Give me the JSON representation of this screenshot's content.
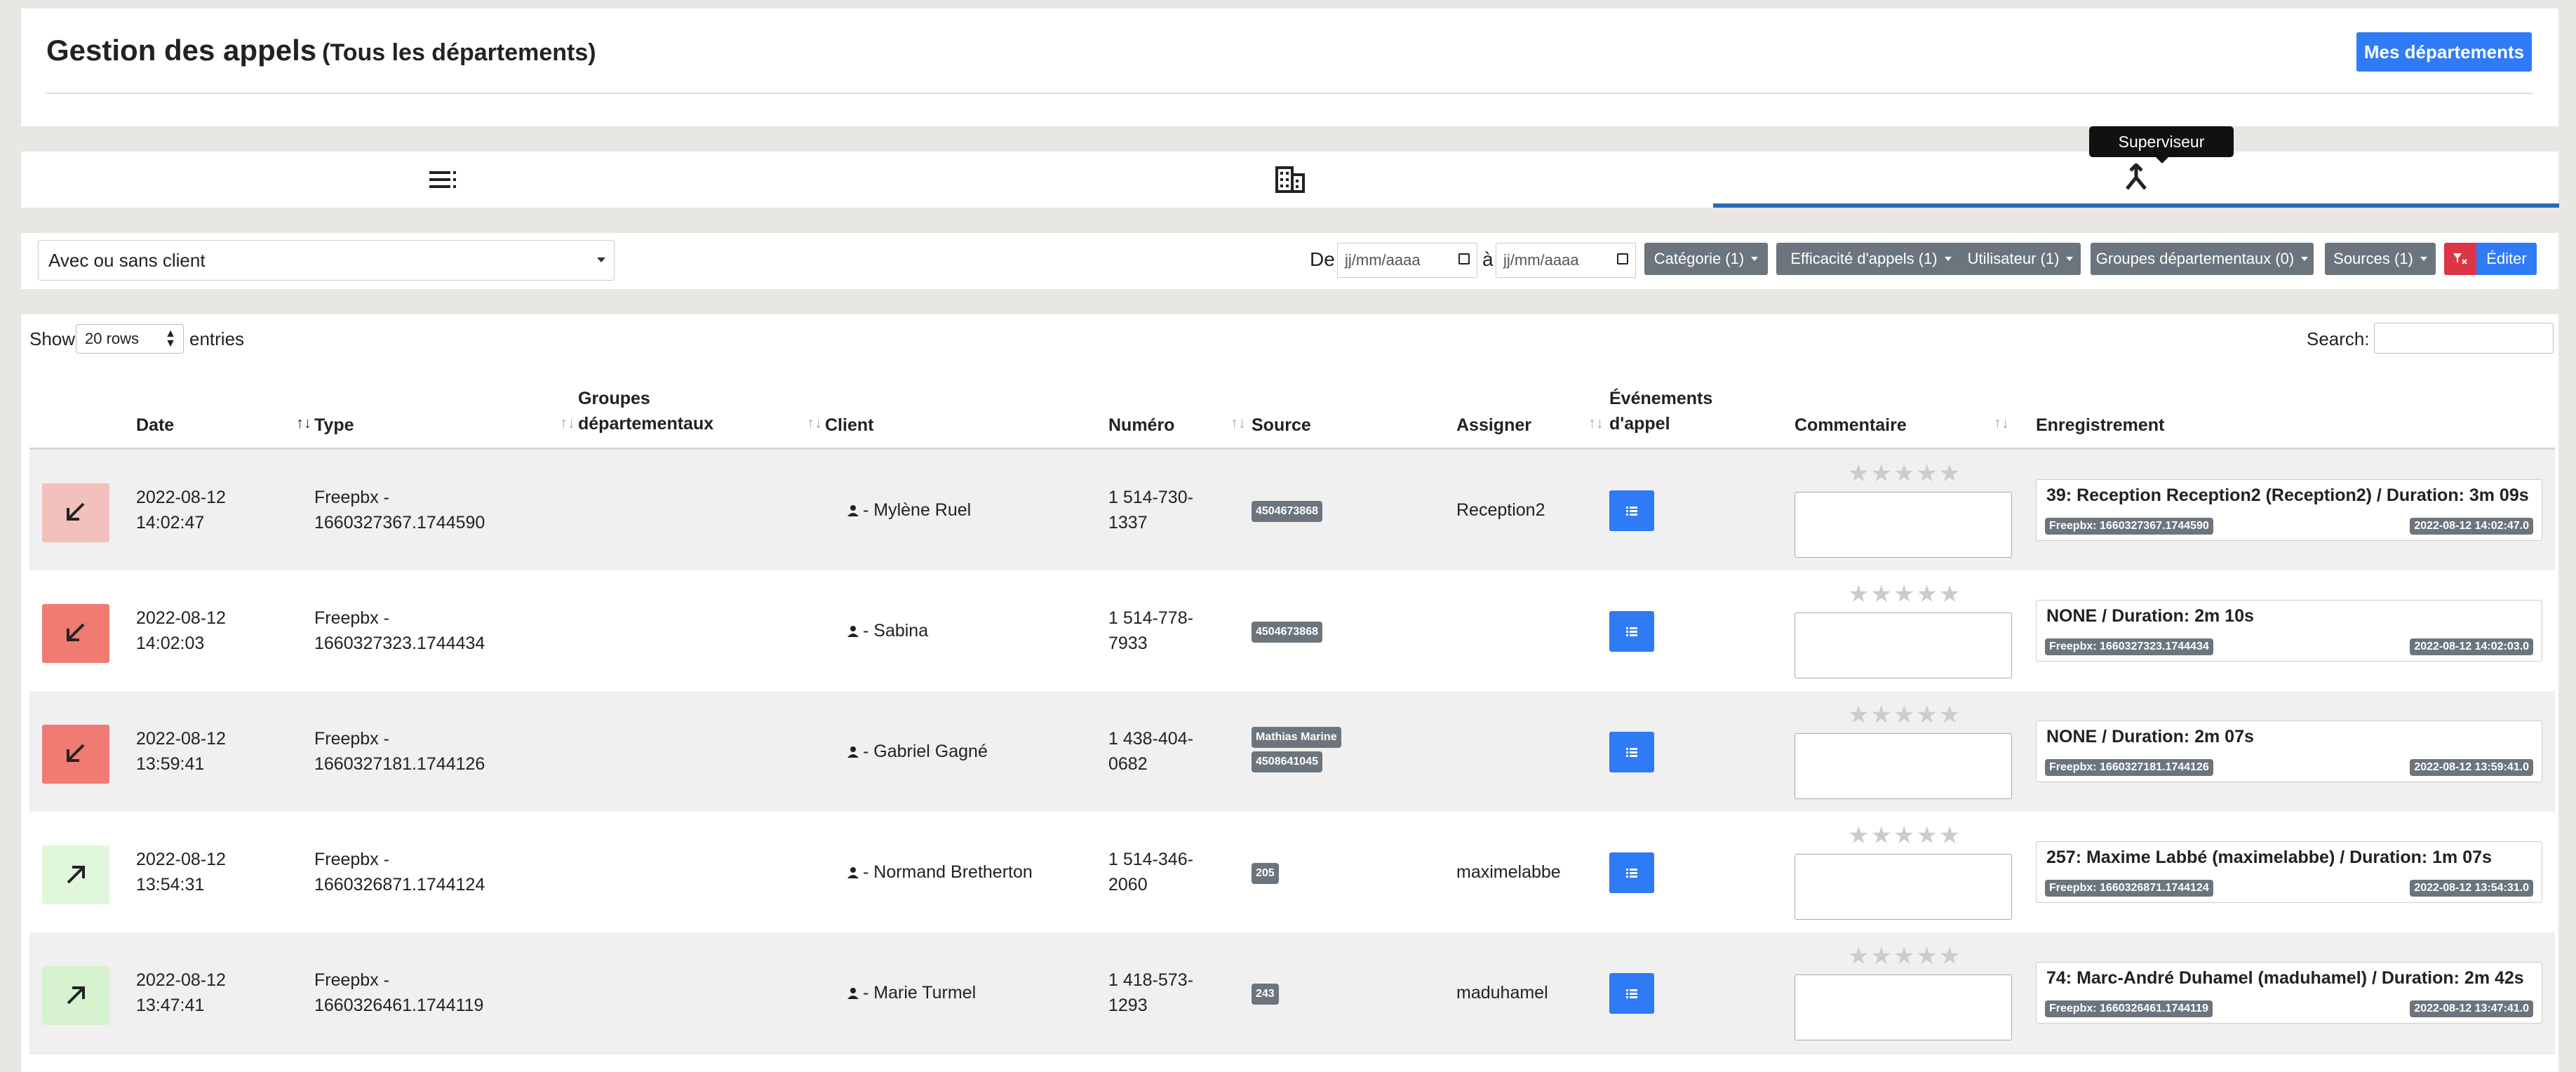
{
  "header": {
    "title": "Gestion des appels",
    "subtitle": "(Tous les départements)",
    "mes_departements": "Mes départements"
  },
  "tabs": {
    "tooltip": "Superviseur",
    "icons": [
      "list-icon",
      "building-icon",
      "merge-icon"
    ],
    "active": 2
  },
  "filters": {
    "client_select": "Avec ou sans client",
    "de_label": "De",
    "a_label": "à",
    "date_placeholder": "jj/mm/aaaa",
    "categorie": "Catégorie (1)",
    "efficacite": "Efficacité d'appels (1)",
    "utilisateur": "Utilisateur (1)",
    "groupes": "Groupes départementaux (0)",
    "sources": "Sources (1)",
    "editer": "Éditer"
  },
  "table_controls": {
    "show": "Show",
    "rows": "20 rows",
    "entries": "entries",
    "search": "Search:"
  },
  "columns": {
    "date": "Date",
    "type": "Type",
    "groupes_1": "Groupes",
    "groupes_2": "départementaux",
    "client": "Client",
    "numero": "Numéro",
    "source": "Source",
    "assigner": "Assigner",
    "evenements_1": "Événements",
    "evenements_2": "d'appel",
    "commentaire": "Commentaire",
    "enregistrement": "Enregistrement"
  },
  "rows": [
    {
      "direction": "incoming",
      "color": "#f2c1bd",
      "date1": "2022-08-12",
      "date2": "14:02:47",
      "type1": "Freepbx -",
      "type2": "1660327367.1744590",
      "client": "- Mylène Ruel",
      "num1": "1 514-730-",
      "num2": "1337",
      "sources": [
        "4504673868"
      ],
      "assigner": "Reception2",
      "rec_title": "39: Reception Reception2 (Reception2) / Duration: 3m 09s",
      "rec_b1": "Freepbx: 1660327367.1744590",
      "rec_b2": "2022-08-12 14:02:47.0"
    },
    {
      "direction": "incoming",
      "color": "#ef7b72",
      "date1": "2022-08-12",
      "date2": "14:02:03",
      "type1": "Freepbx -",
      "type2": "1660327323.1744434",
      "client": "- Sabina",
      "num1": "1 514-778-",
      "num2": "7933",
      "sources": [
        "4504673868"
      ],
      "assigner": "",
      "rec_title": "NONE / Duration: 2m 10s",
      "rec_b1": "Freepbx: 1660327323.1744434",
      "rec_b2": "2022-08-12 14:02:03.0"
    },
    {
      "direction": "incoming",
      "color": "#ef7b72",
      "date1": "2022-08-12",
      "date2": "13:59:41",
      "type1": "Freepbx -",
      "type2": "1660327181.1744126",
      "client": "- Gabriel Gagné",
      "num1": "1 438-404-",
      "num2": "0682",
      "sources": [
        "Mathias Marine",
        "4508641045"
      ],
      "assigner": "",
      "rec_title": "NONE / Duration: 2m 07s",
      "rec_b1": "Freepbx: 1660327181.1744126",
      "rec_b2": "2022-08-12 13:59:41.0"
    },
    {
      "direction": "outgoing",
      "color": "#e1f7dc",
      "date1": "2022-08-12",
      "date2": "13:54:31",
      "type1": "Freepbx -",
      "type2": "1660326871.1744124",
      "client": "- Normand Bretherton",
      "num1": "1 514-346-",
      "num2": "2060",
      "sources": [
        "205"
      ],
      "assigner": "maximelabbe",
      "rec_title": "257: Maxime Labbé (maximelabbe) / Duration: 1m 07s",
      "rec_b1": "Freepbx: 1660326871.1744124",
      "rec_b2": "2022-08-12 13:54:31.0"
    },
    {
      "direction": "outgoing",
      "color": "#d6f2cf",
      "date1": "2022-08-12",
      "date2": "13:47:41",
      "type1": "Freepbx -",
      "type2": "1660326461.1744119",
      "client": "- Marie Turmel",
      "num1": "1 418-573-",
      "num2": "1293",
      "sources": [
        "243"
      ],
      "assigner": "maduhamel",
      "rec_title": "74: Marc-André Duhamel (maduhamel) / Duration: 2m 42s",
      "rec_b1": "Freepbx: 1660326461.1744119",
      "rec_b2": "2022-08-12 13:47:41.0"
    }
  ]
}
